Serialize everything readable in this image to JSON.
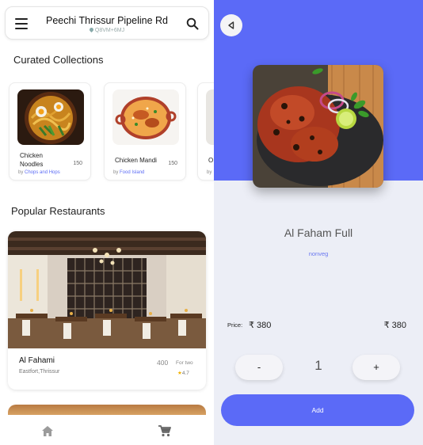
{
  "left": {
    "header": {
      "location_title": "Peechi Thrissur Pipeline Rd",
      "location_sub": "Q8VM+6MJ"
    },
    "curated": {
      "title": "Curated Collections",
      "items": [
        {
          "name": "Chicken Noodles",
          "price": "150",
          "by": "by",
          "source": "Chops and Hops"
        },
        {
          "name": "Chicken Mandi",
          "price": "150",
          "by": "by",
          "source": "Food Island"
        },
        {
          "name": "O",
          "price": "",
          "by": "by",
          "source": ""
        }
      ]
    },
    "popular": {
      "title": "Popular Restaurants",
      "restaurant": {
        "name": "Al Fahami",
        "location": "Eastfort,Thrissur",
        "cost": "400",
        "cost_label": "For two",
        "rating_star": "★",
        "rating": "4.7"
      }
    },
    "nav": {
      "home_icon": "home-icon",
      "cart_icon": "cart-icon"
    }
  },
  "right": {
    "dish_name": "Al Faham Full",
    "dish_type": "nonveg",
    "price_label": "Price:",
    "price": "₹  380",
    "total": "₹  380",
    "qty_minus": "-",
    "qty": "1",
    "qty_plus": "+",
    "add_label": "Add"
  },
  "colors": {
    "accent": "#5b6af7",
    "panel_bg": "#eceef6",
    "rating": "#f2b200"
  }
}
